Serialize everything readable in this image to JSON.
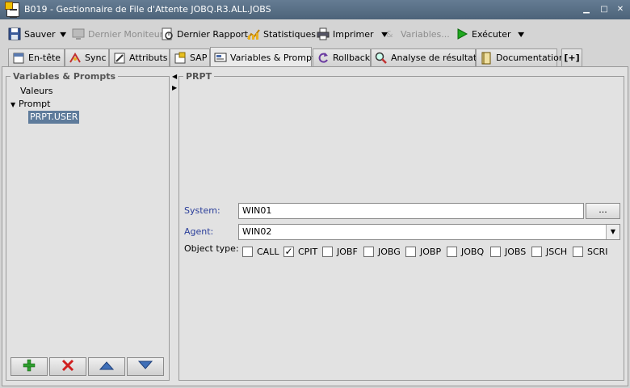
{
  "window": {
    "title": "B019 - Gestionnaire de File d'Attente JOBQ.R3.ALL.JOBS"
  },
  "toolbar": {
    "save": "Sauver",
    "last_monitor": "Dernier Moniteur",
    "last_report": "Dernier Rapport",
    "statistics": "Statistiques",
    "print": "Imprimer",
    "variables": "Variables...",
    "execute": "Exécuter"
  },
  "tabs": [
    {
      "label": "En-tête"
    },
    {
      "label": "Sync"
    },
    {
      "label": "Attributs"
    },
    {
      "label": "SAP"
    },
    {
      "label": "Variables & Prompts"
    },
    {
      "label": "Rollback"
    },
    {
      "label": "Analyse de résultats"
    },
    {
      "label": "Documentation"
    },
    {
      "label": "[+]"
    }
  ],
  "left_panel": {
    "title": "Variables & Prompts",
    "tree": {
      "valeurs": "Valeurs",
      "prompt": "Prompt",
      "prompt_child": "PRPT.USER"
    }
  },
  "right_panel": {
    "title": "PRPT",
    "system": {
      "label": "System:",
      "value": "WIN01",
      "browse": "..."
    },
    "agent": {
      "label": "Agent:",
      "value": "WIN02"
    },
    "object_type": {
      "label": "Object type:",
      "options": [
        {
          "label": "CALL",
          "checked": false
        },
        {
          "label": "CPIT",
          "checked": true
        },
        {
          "label": "JOBF",
          "checked": false
        },
        {
          "label": "JOBG",
          "checked": false
        },
        {
          "label": "JOBP",
          "checked": false
        },
        {
          "label": "JOBQ",
          "checked": false
        },
        {
          "label": "JOBS",
          "checked": false
        },
        {
          "label": "JSCH",
          "checked": false
        },
        {
          "label": "SCRI",
          "checked": false
        }
      ]
    }
  },
  "icons": {
    "checkmark": "✓"
  },
  "colors": {
    "titlebar": "#4d6379",
    "selection": "#5e7b9b",
    "label_blue": "#2a3e9a",
    "add_green": "#2f9e2f",
    "delete_red": "#d02020",
    "arrow_blue": "#3f6fb8"
  }
}
